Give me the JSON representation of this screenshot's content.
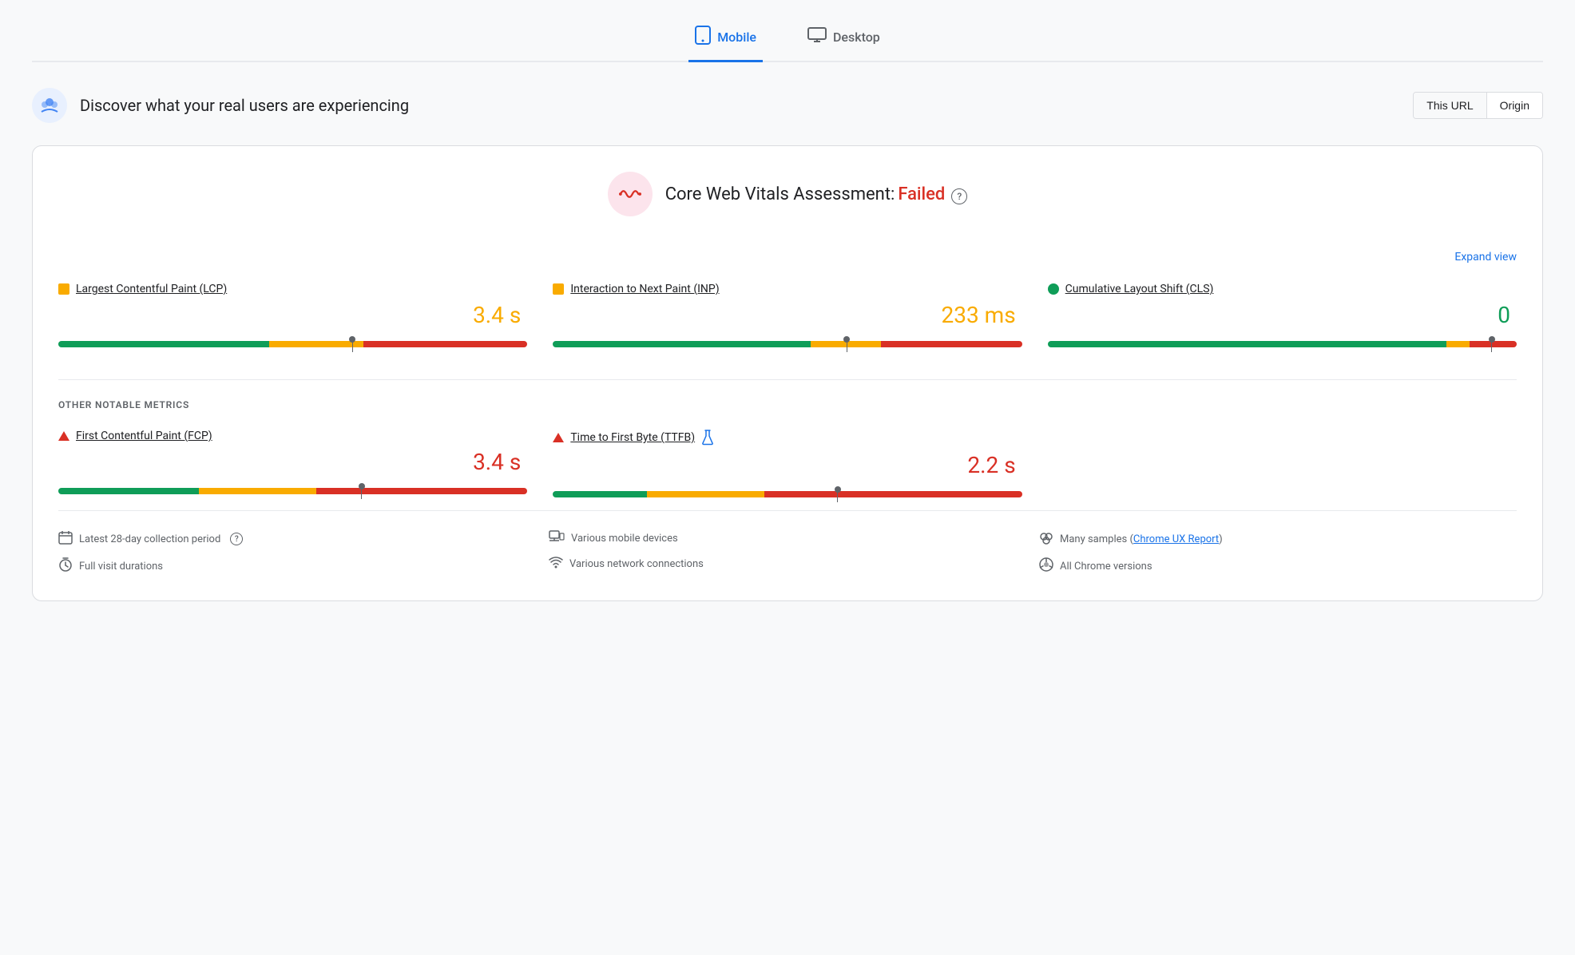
{
  "tabs": [
    {
      "id": "mobile",
      "label": "Mobile",
      "active": true
    },
    {
      "id": "desktop",
      "label": "Desktop",
      "active": false
    }
  ],
  "header": {
    "title": "Discover what your real users are experiencing",
    "url_toggle": {
      "this_url": "This URL",
      "origin": "Origin",
      "active": "this_url"
    }
  },
  "card": {
    "assessment": {
      "title": "Core Web Vitals Assessment:",
      "status": "Failed",
      "expand_label": "Expand view"
    },
    "metrics": [
      {
        "id": "lcp",
        "label": "Largest Contentful Paint (LCP)",
        "dot_color": "orange",
        "value": "3.4 s",
        "value_color": "orange",
        "bar": {
          "green": 45,
          "orange": 20,
          "red": 35
        },
        "marker_pct": 62
      },
      {
        "id": "inp",
        "label": "Interaction to Next Paint (INP)",
        "dot_color": "orange",
        "value": "233 ms",
        "value_color": "orange",
        "bar": {
          "green": 55,
          "orange": 15,
          "red": 30
        },
        "marker_pct": 62
      },
      {
        "id": "cls",
        "label": "Cumulative Layout Shift (CLS)",
        "dot_color": "green",
        "dot_shape": "circle",
        "value": "0",
        "value_color": "green",
        "bar": {
          "green": 85,
          "orange": 5,
          "red": 10
        },
        "marker_pct": 94
      }
    ],
    "other_metrics_label": "OTHER NOTABLE METRICS",
    "other_metrics": [
      {
        "id": "fcp",
        "label": "First Contentful Paint (FCP)",
        "icon": "triangle",
        "value": "3.4 s",
        "value_color": "red",
        "bar": {
          "green": 30,
          "orange": 25,
          "red": 45
        },
        "marker_pct": 64
      },
      {
        "id": "ttfb",
        "label": "Time to First Byte (TTFB)",
        "icon": "triangle",
        "has_flask": true,
        "value": "2.2 s",
        "value_color": "red",
        "bar": {
          "green": 20,
          "orange": 25,
          "red": 55
        },
        "marker_pct": 60
      }
    ],
    "footer": {
      "col1": [
        {
          "icon": "📅",
          "text": "Latest 28-day collection period",
          "has_help": true
        },
        {
          "icon": "⏱",
          "text": "Full visit durations"
        }
      ],
      "col2": [
        {
          "icon": "📱",
          "text": "Various mobile devices"
        },
        {
          "icon": "📶",
          "text": "Various network connections"
        }
      ],
      "col3": [
        {
          "icon": "👥",
          "text": "Many samples",
          "link": "Chrome UX Report"
        },
        {
          "icon": "🔵",
          "text": "All Chrome versions"
        }
      ]
    }
  }
}
